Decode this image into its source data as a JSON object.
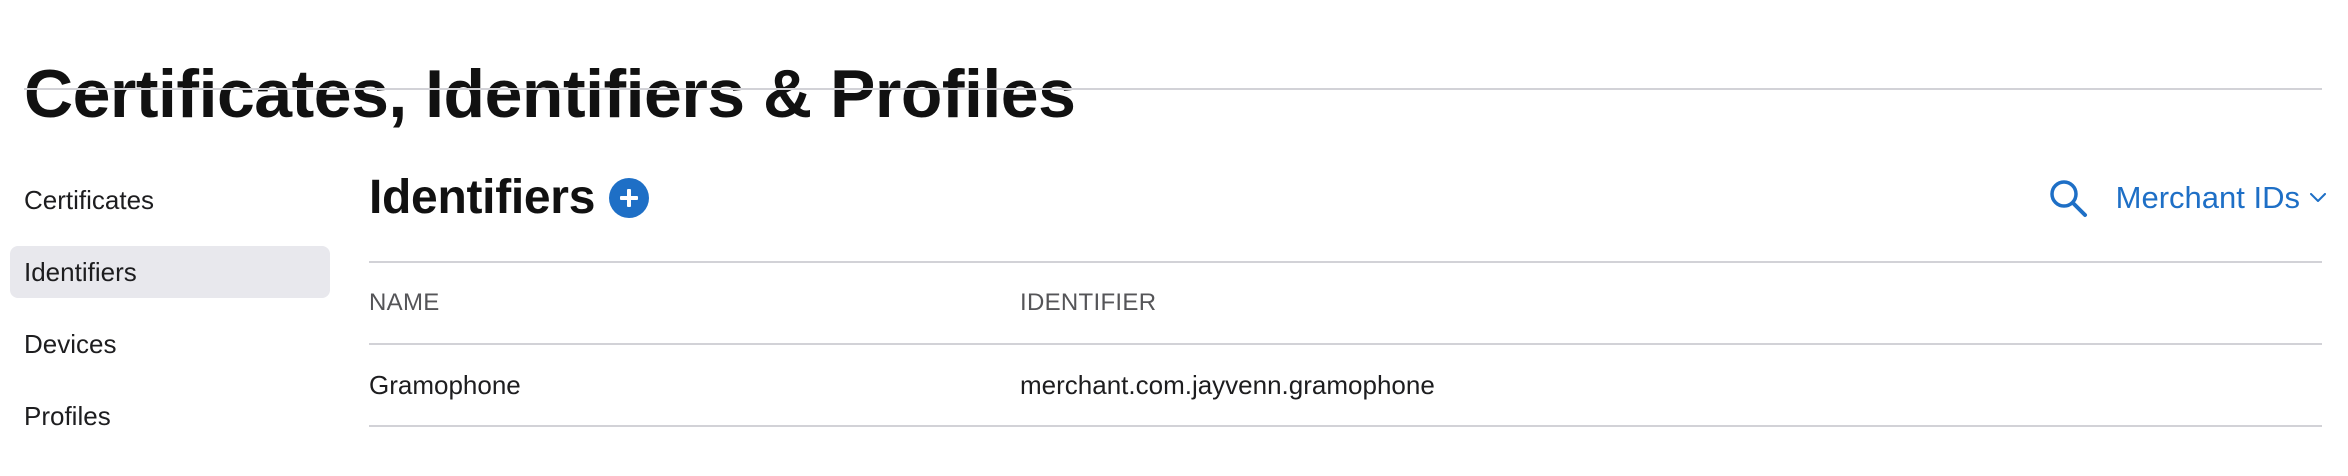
{
  "header": {
    "title": "Certificates, Identifiers & Profiles"
  },
  "sidebar": {
    "items": [
      {
        "label": "Certificates",
        "active": false
      },
      {
        "label": "Identifiers",
        "active": true
      },
      {
        "label": "Devices",
        "active": false
      },
      {
        "label": "Profiles",
        "active": false
      }
    ]
  },
  "main": {
    "heading": "Identifiers",
    "add_icon": "plus-circle-icon",
    "search_icon": "search-icon",
    "filter": {
      "selected": "Merchant IDs",
      "icon": "chevron-down-icon"
    },
    "table": {
      "columns": [
        "NAME",
        "IDENTIFIER"
      ],
      "rows": [
        {
          "name": "Gramophone",
          "identifier": "merchant.com.jayvenn.gramophone"
        }
      ]
    }
  },
  "colors": {
    "accent": "#1e6fc6",
    "divider": "#d2d2d7",
    "active_item_bg": "#e8e8ed",
    "text": "#1d1d1f"
  }
}
